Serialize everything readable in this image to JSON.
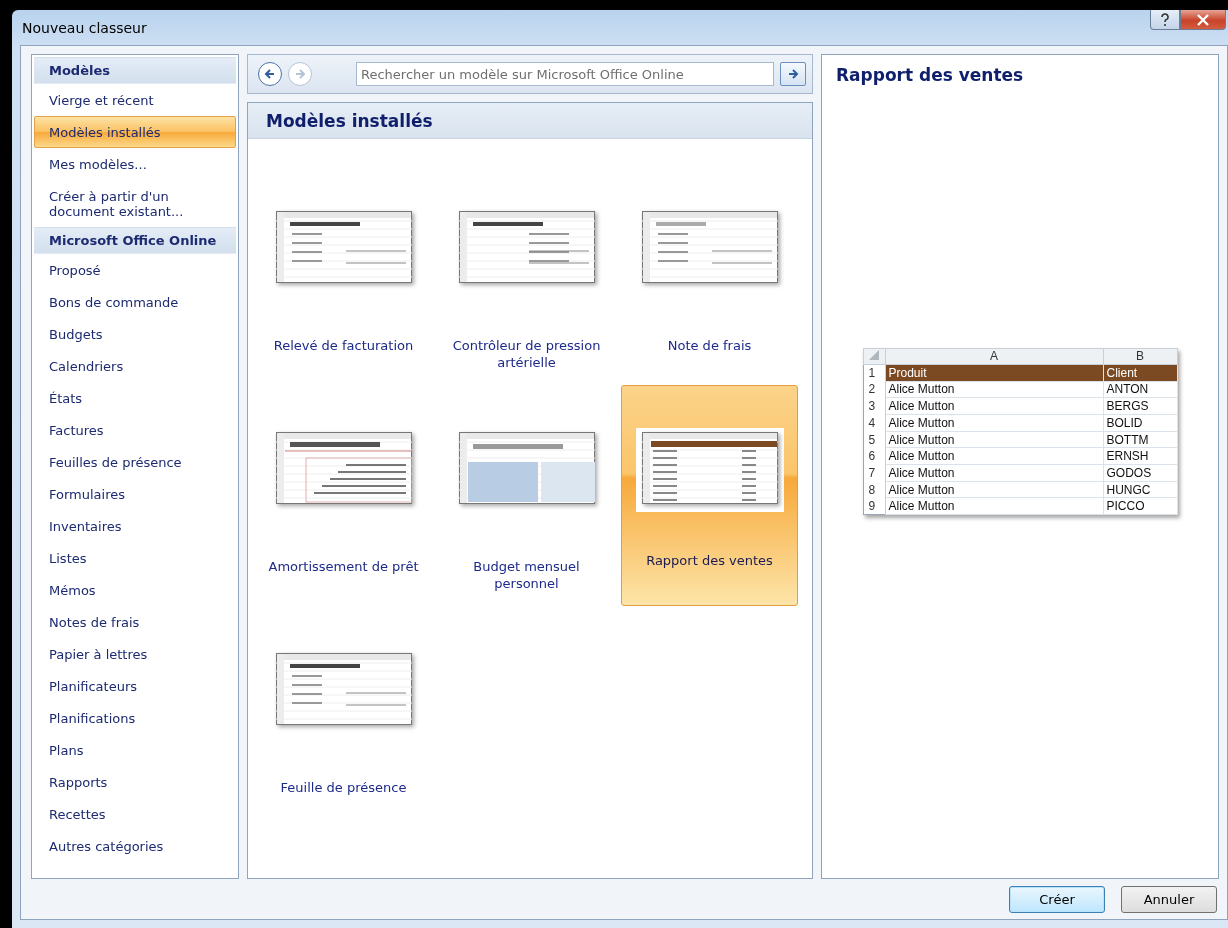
{
  "window": {
    "title": "Nouveau classeur"
  },
  "sidebar": {
    "items": [
      {
        "label": "Modèles",
        "kind": "header",
        "selected": false
      },
      {
        "label": "Vierge et récent",
        "kind": "item",
        "selected": false
      },
      {
        "label": "Modèles installés",
        "kind": "item",
        "selected": true
      },
      {
        "label": "Mes modèles...",
        "kind": "item",
        "selected": false
      },
      {
        "label": "Créer à partir d'un document existant...",
        "kind": "item",
        "selected": false
      },
      {
        "label": "Microsoft Office Online",
        "kind": "header",
        "selected": false
      },
      {
        "label": "Proposé",
        "kind": "item",
        "selected": false
      },
      {
        "label": "Bons de commande",
        "kind": "item",
        "selected": false
      },
      {
        "label": "Budgets",
        "kind": "item",
        "selected": false
      },
      {
        "label": "Calendriers",
        "kind": "item",
        "selected": false
      },
      {
        "label": "États",
        "kind": "item",
        "selected": false
      },
      {
        "label": "Factures",
        "kind": "item",
        "selected": false
      },
      {
        "label": "Feuilles de présence",
        "kind": "item",
        "selected": false
      },
      {
        "label": "Formulaires",
        "kind": "item",
        "selected": false
      },
      {
        "label": "Inventaires",
        "kind": "item",
        "selected": false
      },
      {
        "label": "Listes",
        "kind": "item",
        "selected": false
      },
      {
        "label": "Mémos",
        "kind": "item",
        "selected": false
      },
      {
        "label": "Notes de frais",
        "kind": "item",
        "selected": false
      },
      {
        "label": "Papier à lettres",
        "kind": "item",
        "selected": false
      },
      {
        "label": "Planificateurs",
        "kind": "item",
        "selected": false
      },
      {
        "label": "Planifications",
        "kind": "item",
        "selected": false
      },
      {
        "label": "Plans",
        "kind": "item",
        "selected": false
      },
      {
        "label": "Rapports",
        "kind": "item",
        "selected": false
      },
      {
        "label": "Recettes",
        "kind": "item",
        "selected": false
      },
      {
        "label": "Autres catégories",
        "kind": "item",
        "selected": false
      }
    ]
  },
  "search": {
    "placeholder": "Rechercher un modèle sur Microsoft Office Online"
  },
  "gallery": {
    "title": "Modèles installés",
    "templates": [
      {
        "label": "Relevé de facturation",
        "selected": false
      },
      {
        "label": "Contrôleur de pression artérielle",
        "selected": false
      },
      {
        "label": "Note de frais",
        "selected": false
      },
      {
        "label": "Amortissement de prêt",
        "selected": false
      },
      {
        "label": "Budget mensuel personnel",
        "selected": false
      },
      {
        "label": "Rapport des ventes",
        "selected": true
      },
      {
        "label": "Feuille de présence",
        "selected": false
      }
    ]
  },
  "preview": {
    "title": "Rapport des ventes",
    "columns": [
      "A",
      "B"
    ],
    "rows": [
      {
        "number": "1",
        "cells": [
          "Produit",
          "Client"
        ],
        "header": true
      },
      {
        "number": "2",
        "cells": [
          "Alice Mutton",
          "ANTON"
        ],
        "header": false
      },
      {
        "number": "3",
        "cells": [
          "Alice Mutton",
          "BERGS"
        ],
        "header": false
      },
      {
        "number": "4",
        "cells": [
          "Alice Mutton",
          "BOLID"
        ],
        "header": false
      },
      {
        "number": "5",
        "cells": [
          "Alice Mutton",
          "BOTTM"
        ],
        "header": false
      },
      {
        "number": "6",
        "cells": [
          "Alice Mutton",
          "ERNSH"
        ],
        "header": false
      },
      {
        "number": "7",
        "cells": [
          "Alice Mutton",
          "GODOS"
        ],
        "header": false
      },
      {
        "number": "8",
        "cells": [
          "Alice Mutton",
          "HUNGC"
        ],
        "header": false
      },
      {
        "number": "9",
        "cells": [
          "Alice Mutton",
          "PICCO"
        ],
        "header": false
      }
    ]
  },
  "buttons": [
    {
      "label": "Créer",
      "kind": "primary"
    },
    {
      "label": "Annuler",
      "kind": "secondary"
    }
  ]
}
